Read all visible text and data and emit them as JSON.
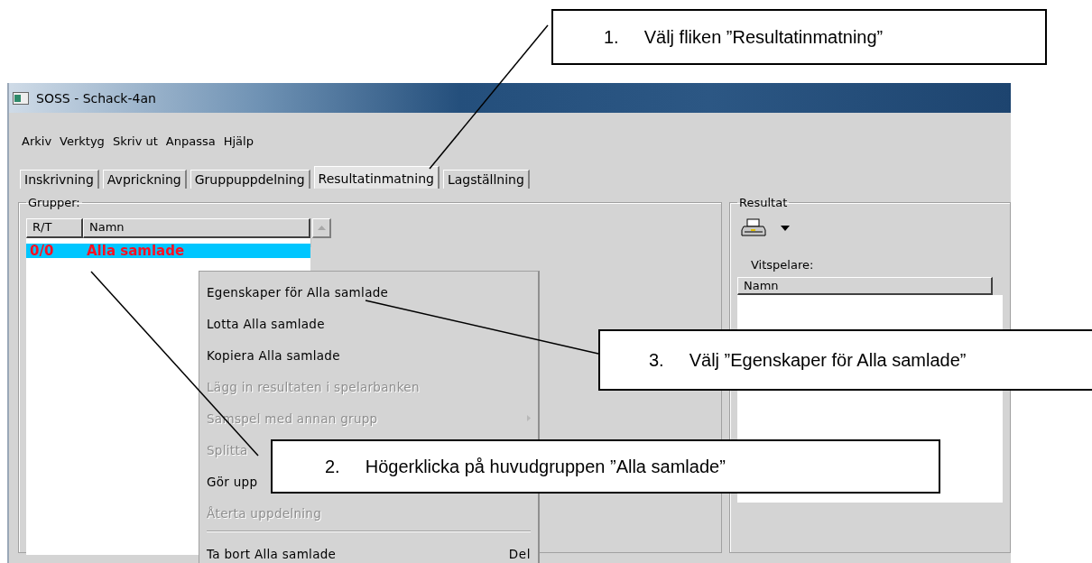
{
  "window": {
    "title": "SOSS - Schack-4an"
  },
  "menu_bar": [
    "Arkiv",
    "Verktyg",
    "Skriv ut",
    "Anpassa",
    "Hjälp"
  ],
  "tabs": [
    {
      "label": "Inskrivning",
      "selected": false
    },
    {
      "label": "Avprickning",
      "selected": false
    },
    {
      "label": "Gruppuppdelning",
      "selected": false
    },
    {
      "label": "Resultatinmatning",
      "selected": true
    },
    {
      "label": "Lagställning",
      "selected": false
    }
  ],
  "groups_panel": {
    "title": "Grupper:",
    "columns": [
      "R/T",
      "Namn"
    ],
    "rows": [
      {
        "rt": "0/0",
        "name": "Alla samlade",
        "selected": true
      }
    ]
  },
  "result_panel": {
    "title": "Resultat",
    "white_players_label": "Vitspelare:",
    "columns": [
      "Namn"
    ]
  },
  "context_menu": [
    {
      "kind": "item",
      "label": "Egenskaper för Alla samlade",
      "disabled": false
    },
    {
      "kind": "item",
      "label": "Lotta Alla samlade",
      "disabled": false
    },
    {
      "kind": "item",
      "label": "Kopiera Alla samlade",
      "disabled": false
    },
    {
      "kind": "item",
      "label": "Lägg in resultaten i spelarbanken",
      "disabled": true
    },
    {
      "kind": "submenu",
      "label": "Samspel med annan grupp",
      "disabled": true
    },
    {
      "kind": "item",
      "label": "Splitta",
      "disabled": true
    },
    {
      "kind": "item",
      "label": "Gör upp",
      "disabled": false
    },
    {
      "kind": "item",
      "label": "Återta uppdelning",
      "disabled": true
    },
    {
      "kind": "separator"
    },
    {
      "kind": "item",
      "label": "Ta bort Alla samlade",
      "shortcut": "Del",
      "disabled": false
    }
  ],
  "callouts": [
    {
      "number": "1.",
      "text": "Välj fliken ”Resultatinmatning”"
    },
    {
      "number": "2.",
      "text": "Högerklicka på huvudgruppen ”Alla samlade”"
    },
    {
      "number": "3.",
      "text": "Välj ”Egenskaper för Alla samlade”"
    }
  ]
}
